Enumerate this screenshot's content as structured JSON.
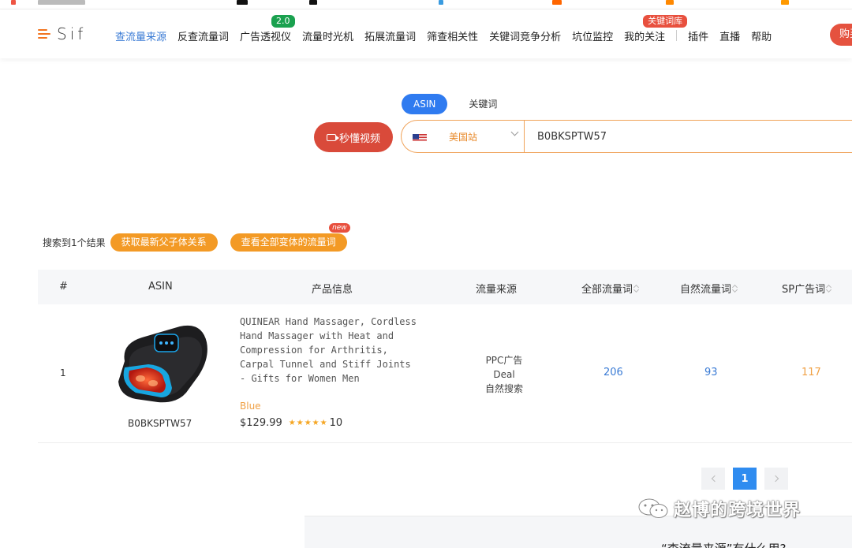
{
  "header": {
    "logo_text": "Sif",
    "nav": [
      {
        "label": "查流量来源",
        "active": true
      },
      {
        "label": "反查流量词"
      },
      {
        "label": "广告透视仪",
        "badge": "2.0"
      },
      {
        "label": "流量时光机"
      },
      {
        "label": "拓展流量词"
      },
      {
        "label": "筛查相关性"
      },
      {
        "label": "关键词竞争分析"
      },
      {
        "label": "坑位监控"
      },
      {
        "label": "我的关注",
        "badge": "关键词库"
      }
    ],
    "nav_right": [
      {
        "label": "插件"
      },
      {
        "label": "直播"
      },
      {
        "label": "帮助"
      }
    ],
    "buy_label": "购买"
  },
  "search": {
    "tabs": [
      {
        "label": "ASIN",
        "active": true
      },
      {
        "label": "关键词"
      }
    ],
    "video_button": "秒懂视频",
    "site": "美国站",
    "query": "B0BKSPTW57"
  },
  "results": {
    "summary": "搜索到1个结果",
    "btn_parent_child": "获取最新父子体关系",
    "btn_variants": "查看全部变体的流量词",
    "new_tag": "new"
  },
  "table": {
    "headers": {
      "num": "#",
      "asin": "ASIN",
      "product": "产品信息",
      "source": "流量来源",
      "all_kw": "全部流量词",
      "organic_kw": "自然流量词",
      "sp_kw": "SP广告词"
    },
    "rows": [
      {
        "num": "1",
        "asin": "B0BKSPTW57",
        "title": "QUINEAR Hand Massager, Cordless Hand Massager with Heat and Compression for Arthritis, Carpal Tunnel and Stiff Joints - Gifts for Women Men",
        "variant": "Blue",
        "price": "$129.99",
        "stars": "★★★★★",
        "reviews": "10",
        "sources": [
          "PPC广告",
          "Deal",
          "自然搜索"
        ],
        "all_kw": "206",
        "organic_kw": "93",
        "sp_kw": "117"
      }
    ]
  },
  "pagination": {
    "current": "1"
  },
  "bottom": {
    "text": "“查流量来源”有什么用?"
  },
  "watermark": {
    "text": "赵博的跨境世界"
  },
  "colors": {
    "accent_blue": "#2f7bf0",
    "orange": "#f39a25",
    "red": "#e5523f"
  }
}
